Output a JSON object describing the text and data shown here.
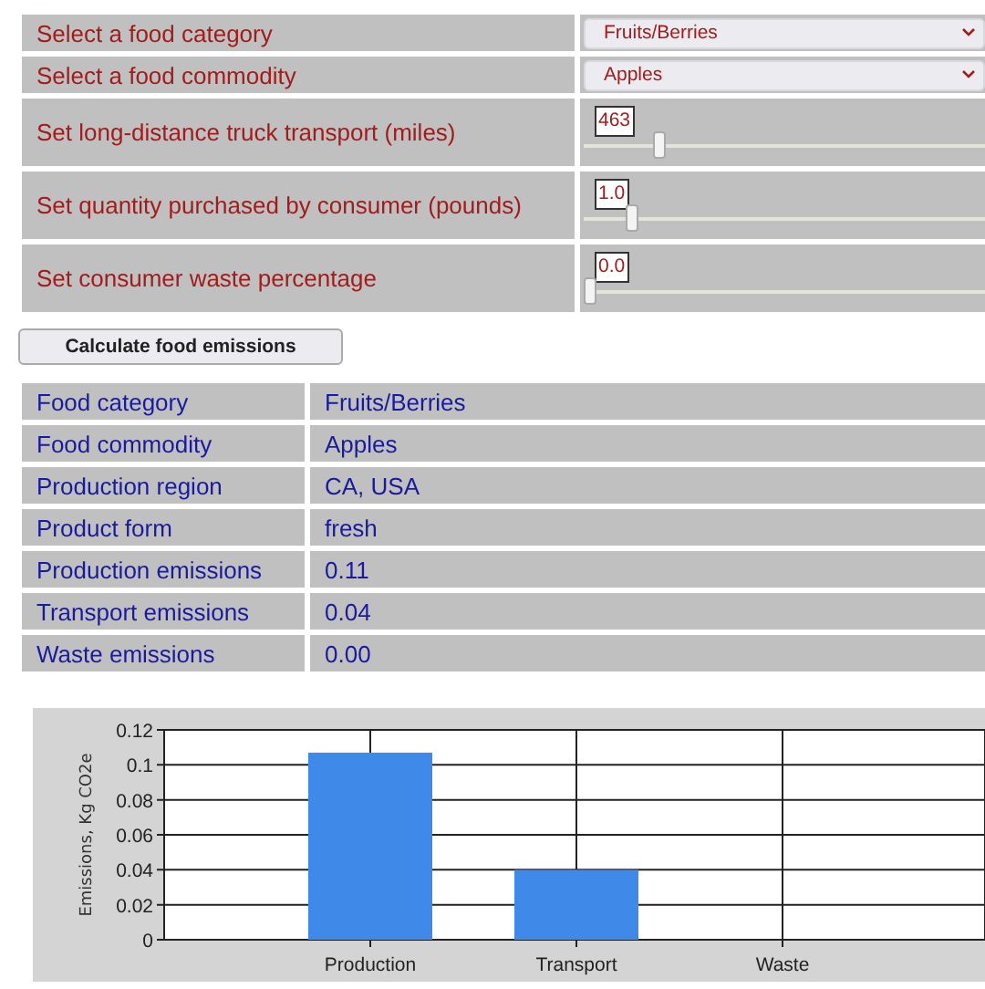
{
  "form": {
    "selects": [
      {
        "label": "Select a food category",
        "value": "Fruits/Berries"
      },
      {
        "label": "Select a food commodity",
        "value": "Apples"
      }
    ],
    "sliders": [
      {
        "label": "Set long-distance truck transport (miles)",
        "value": "463",
        "level": 0.18
      },
      {
        "label": "Set quantity purchased by consumer (pounds)",
        "value": "1.0",
        "level": 0.11
      },
      {
        "label": "Set consumer waste percentage",
        "value": "0.0",
        "level": 0
      }
    ]
  },
  "calculate_button": "Calculate food emissions",
  "results": [
    {
      "label": "Food category",
      "value": "Fruits/Berries"
    },
    {
      "label": "Food commodity",
      "value": "Apples"
    },
    {
      "label": "Production region",
      "value": "CA, USA"
    },
    {
      "label": "Product form",
      "value": "fresh"
    },
    {
      "label": "Production emissions",
      "value": "0.11"
    },
    {
      "label": "Transport emissions",
      "value": "0.04"
    },
    {
      "label": "Waste emissions",
      "value": "0.00"
    }
  ],
  "chart": {
    "chart_data": {
      "type": "bar",
      "ylabel": "Emissions, Kg CO2e",
      "categories": [
        "Production",
        "Transport",
        "Waste"
      ],
      "grid": true,
      "series": [
        {
          "color": "#3f8ae8",
          "values": [
            0.107,
            0.04,
            0
          ]
        }
      ],
      "ylim": [
        0,
        0.12
      ],
      "yticks": [
        0,
        0.02,
        0.04,
        0.06,
        0.08,
        {
          "value": 0.1,
          "label": "0.1"
        },
        0.12
      ]
    }
  }
}
